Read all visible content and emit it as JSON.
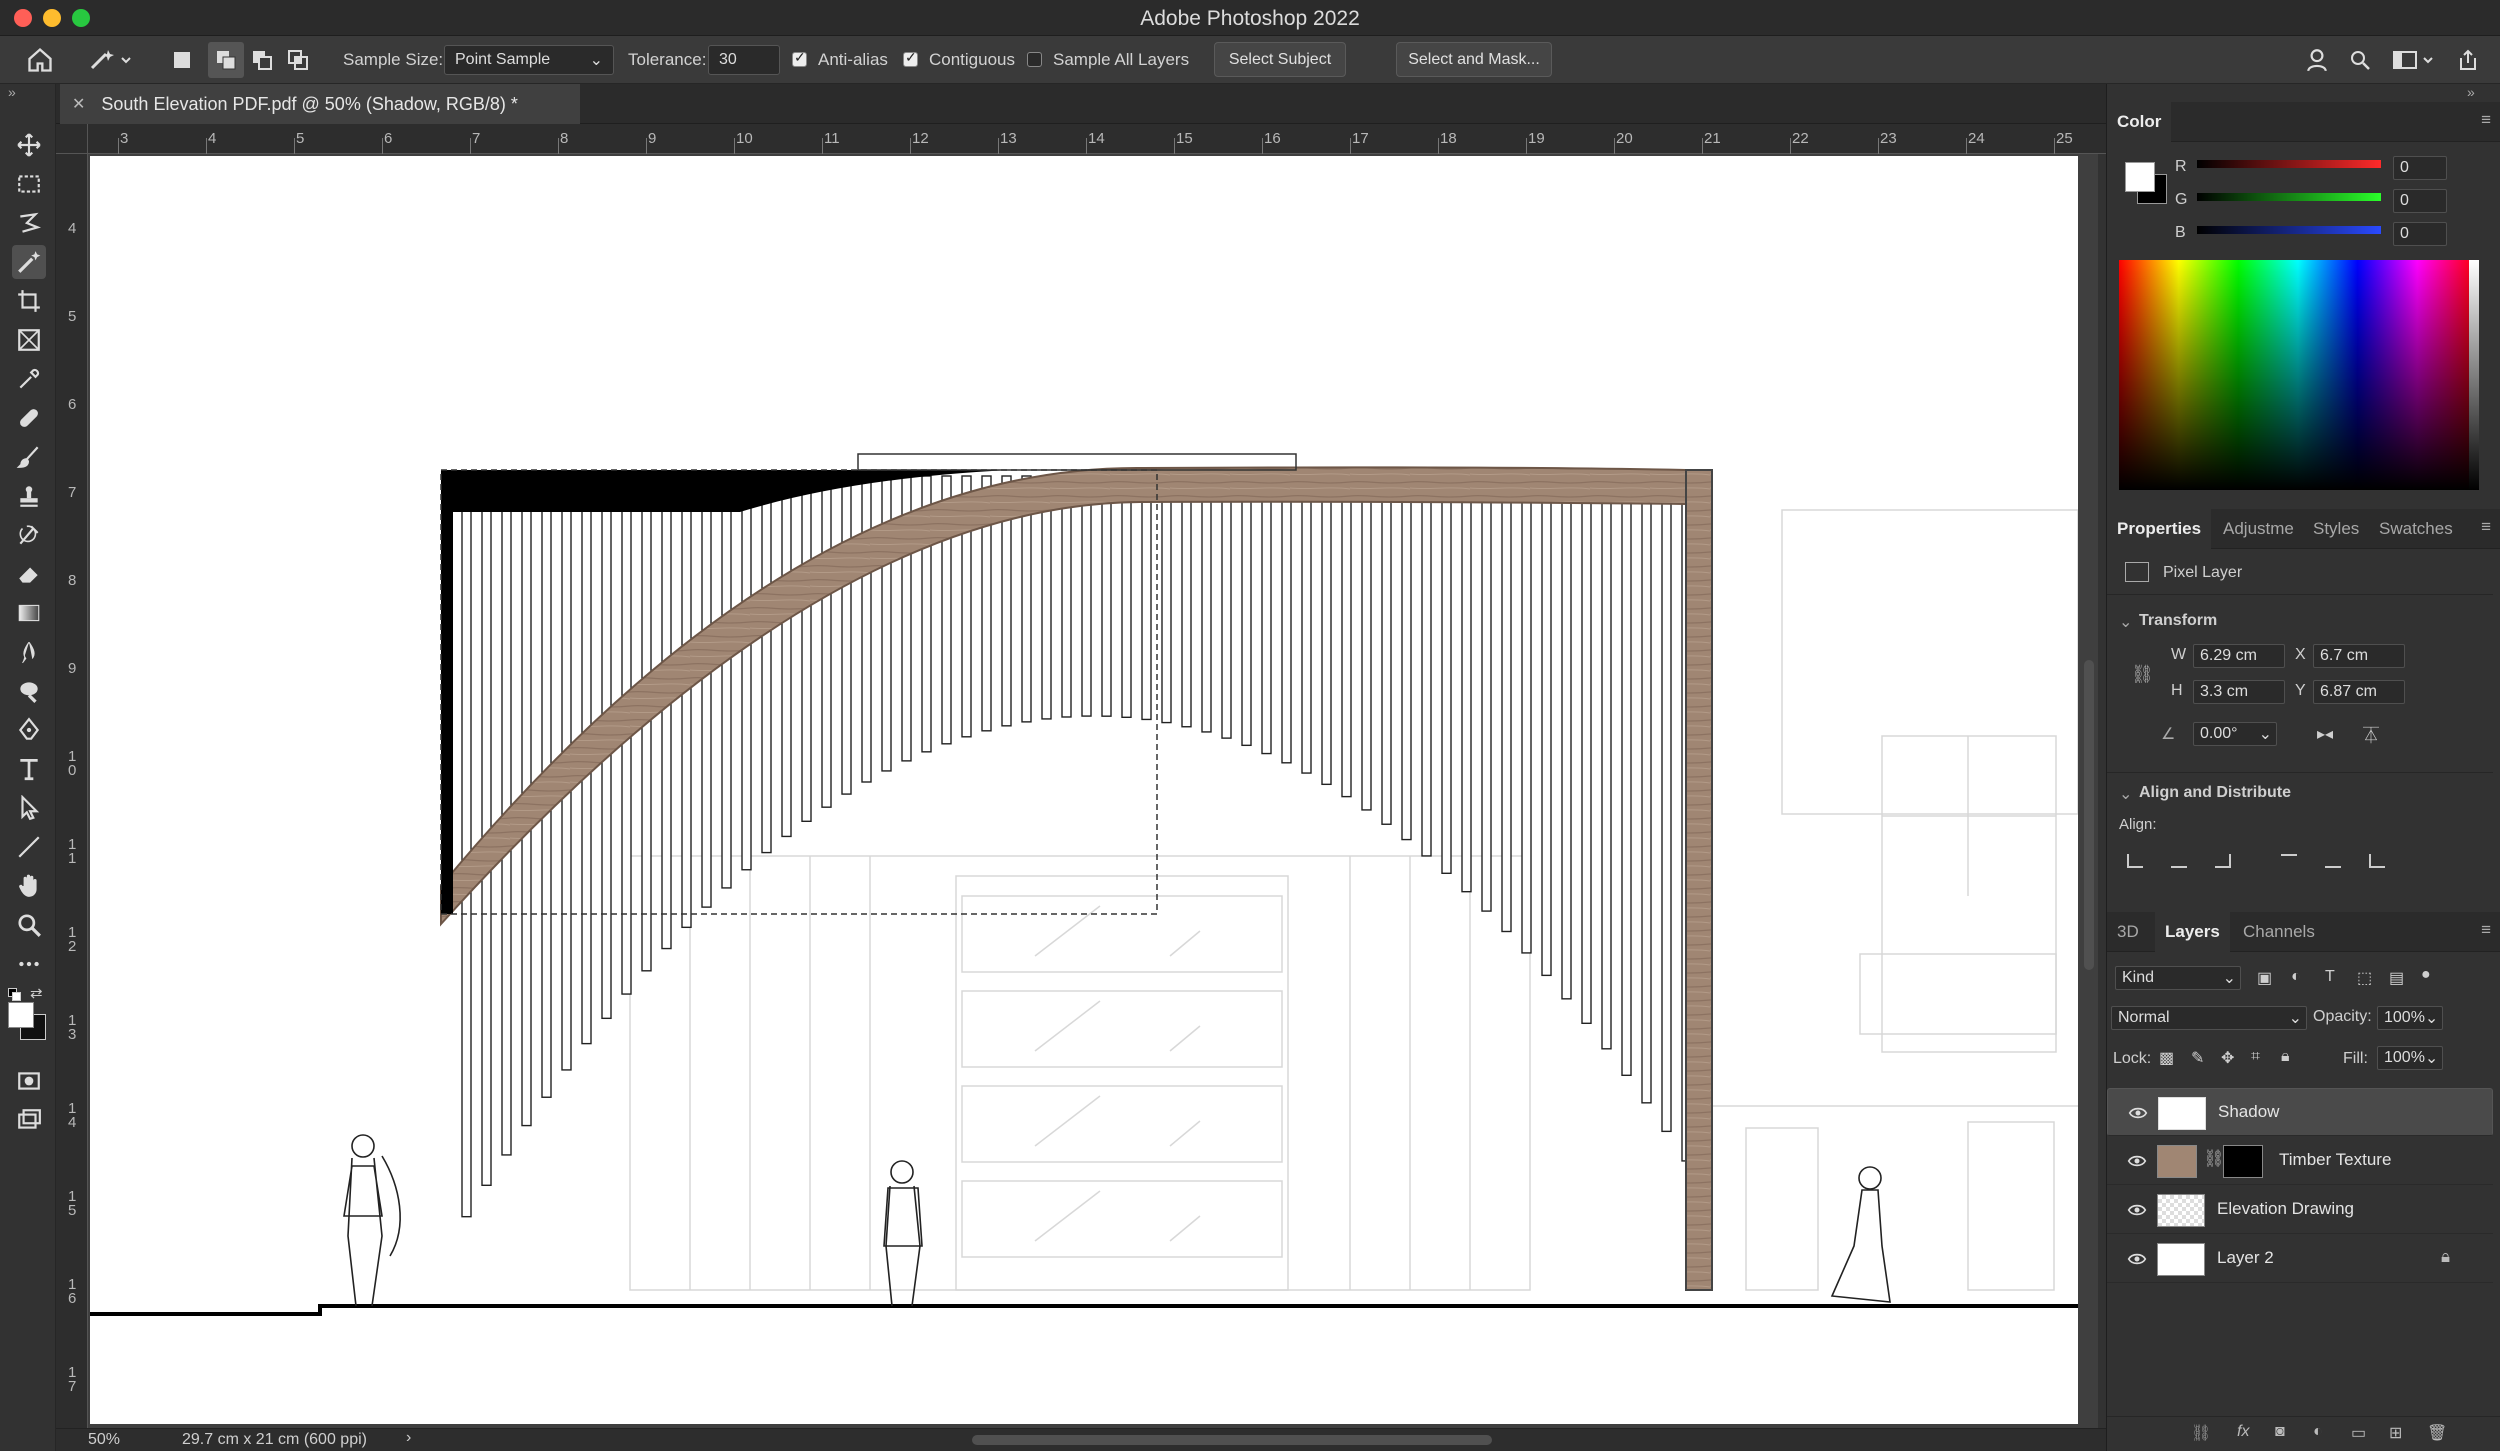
{
  "app": {
    "title": "Adobe Photoshop 2022"
  },
  "options_bar": {
    "sample_size_label": "Sample Size:",
    "sample_size_value": "Point Sample",
    "tolerance_label": "Tolerance:",
    "tolerance_value": "30",
    "anti_alias_label": "Anti-alias",
    "anti_alias_checked": true,
    "contiguous_label": "Contiguous",
    "contiguous_checked": true,
    "sample_all_layers_label": "Sample All Layers",
    "sample_all_layers_checked": false,
    "select_subject_label": "Select Subject",
    "select_and_mask_label": "Select and Mask..."
  },
  "document": {
    "tab_title": "South Elevation PDF.pdf @ 50% (Shadow, RGB/8) *",
    "ruler_h": [
      "3",
      "4",
      "5",
      "6",
      "7",
      "8",
      "9",
      "10",
      "11",
      "12",
      "13",
      "14",
      "15",
      "16",
      "17",
      "18",
      "19",
      "20",
      "21",
      "22",
      "23",
      "24",
      "25"
    ],
    "ruler_v": [
      "4",
      "5",
      "6",
      "7",
      "8",
      "9",
      "1\n0",
      "1\n1",
      "1\n2",
      "1\n3",
      "1\n4",
      "1\n5",
      "1\n6",
      "1\n7"
    ]
  },
  "status": {
    "zoom": "50%",
    "doc_size": "29.7 cm x 21 cm (600 ppi)"
  },
  "color_panel": {
    "title": "Color",
    "r_label": "R",
    "r_value": "0",
    "g_label": "G",
    "g_value": "0",
    "b_label": "B",
    "b_value": "0"
  },
  "properties_panel": {
    "tabs": [
      "Properties",
      "Adjustme",
      "Styles",
      "Swatches"
    ],
    "layer_type": "Pixel Layer",
    "transform_title": "Transform",
    "w_label": "W",
    "w_value": "6.29 cm",
    "h_label": "H",
    "h_value": "3.3 cm",
    "x_label": "X",
    "x_value": "6.7 cm",
    "y_label": "Y",
    "y_value": "6.87 cm",
    "angle_value": "0.00°",
    "align_title": "Align and Distribute",
    "align_label": "Align:"
  },
  "layers_panel": {
    "tabs": [
      "3D",
      "Layers",
      "Channels"
    ],
    "filter_kind": "Kind",
    "blend_mode": "Normal",
    "opacity_label": "Opacity:",
    "opacity_value": "100%",
    "lock_label": "Lock:",
    "fill_label": "Fill:",
    "fill_value": "100%",
    "layers": [
      {
        "name": "Shadow"
      },
      {
        "name": "Timber Texture"
      },
      {
        "name": "Elevation Drawing"
      },
      {
        "name": "Layer 2"
      }
    ]
  }
}
